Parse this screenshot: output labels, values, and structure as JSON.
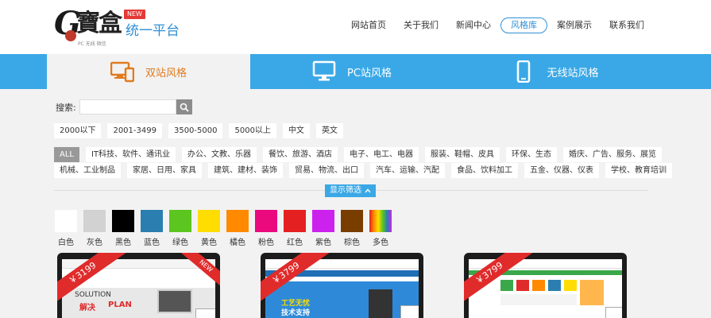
{
  "brand": {
    "logo_text": "寶盒",
    "logo_letter": "G",
    "new_badge": "NEW",
    "platform": "统一平台",
    "tagline": "PC  无线  微信"
  },
  "nav": {
    "items": [
      {
        "label": "网站首页"
      },
      {
        "label": "关于我们"
      },
      {
        "label": "新闻中心"
      },
      {
        "label": "风格库"
      },
      {
        "label": "案例展示"
      },
      {
        "label": "联系我们"
      }
    ]
  },
  "tabs": [
    {
      "label": "双站风格",
      "icon": "pc-mobile-icon"
    },
    {
      "label": "PC站风格",
      "icon": "monitor-icon"
    },
    {
      "label": "无线站风格",
      "icon": "phone-icon"
    }
  ],
  "search": {
    "label": "搜索:",
    "placeholder": "",
    "icon": "search-icon"
  },
  "price_filters": [
    "2000以下",
    "2001-3499",
    "3500-5000",
    "5000以上",
    "中文",
    "英文"
  ],
  "industry_filters": {
    "row1": [
      "ALL",
      "IT科技、软件、通讯业",
      "办公、文教、乐器",
      "餐饮、旅游、酒店",
      "电子、电工、电器",
      "服装、鞋帽、皮具",
      "环保、生态",
      "婚庆、广告、服务、展览"
    ],
    "row2": [
      "机械、工业制品",
      "家居、日用、家具",
      "建筑、建材、装饰",
      "贸易、物流、出口",
      "汽车、运输、汽配",
      "食品、饮料加工",
      "五金、仪器、仪表",
      "学校、教育培训"
    ]
  },
  "toggle": {
    "label": "显示筛选"
  },
  "colors": [
    {
      "name": "白色",
      "hex": "#ffffff"
    },
    {
      "name": "灰色",
      "hex": "#d2d2d2"
    },
    {
      "name": "黑色",
      "hex": "#000000"
    },
    {
      "name": "蓝色",
      "hex": "#2a7fb0"
    },
    {
      "name": "绿色",
      "hex": "#5cc51f"
    },
    {
      "name": "黄色",
      "hex": "#ffdd00"
    },
    {
      "name": "橘色",
      "hex": "#ff8a00"
    },
    {
      "name": "粉色",
      "hex": "#ea0a7e"
    },
    {
      "name": "红色",
      "hex": "#e52020"
    },
    {
      "name": "紫色",
      "hex": "#cc22ee"
    },
    {
      "name": "棕色",
      "hex": "#7a3d00"
    },
    {
      "name": "多色",
      "hex": "rainbow"
    }
  ],
  "cards": [
    {
      "price": "￥3199",
      "badge": "NEW",
      "preview_lines": [
        "SOLUTION",
        "解决",
        "PLAN"
      ]
    },
    {
      "price": "￥3799",
      "badge": "",
      "preview_lines": [
        "工艺无忧",
        "技术支持"
      ]
    },
    {
      "price": "￥3799",
      "badge": "",
      "preview_lines": []
    }
  ]
}
